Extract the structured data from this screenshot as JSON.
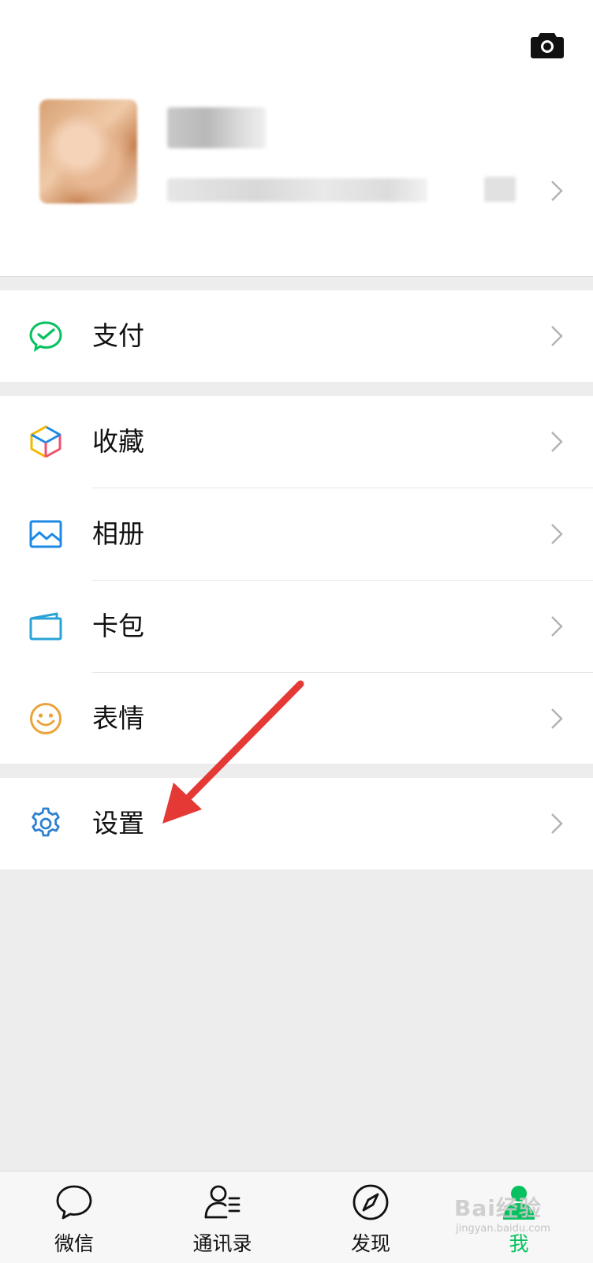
{
  "profile": {
    "camera_icon": "camera-icon",
    "chevron_icon": "chevron-right-icon"
  },
  "menu": {
    "pay": {
      "label": "支付",
      "icon": "wechat-pay-icon",
      "color": "#07c160"
    },
    "favorites": {
      "label": "收藏",
      "icon": "favorites-cube-icon"
    },
    "album": {
      "label": "相册",
      "icon": "album-image-icon",
      "color": "#1e8ae6"
    },
    "cards": {
      "label": "卡包",
      "icon": "card-wallet-icon",
      "color": "#2aa3d6"
    },
    "stickers": {
      "label": "表情",
      "icon": "emoji-smile-icon",
      "color": "#eba43a"
    },
    "settings": {
      "label": "设置",
      "icon": "gear-icon",
      "color": "#2f81d1"
    }
  },
  "tabs": [
    {
      "label": "微信",
      "icon": "chat-bubble-icon"
    },
    {
      "label": "通讯录",
      "icon": "contacts-icon"
    },
    {
      "label": "发现",
      "icon": "compass-icon"
    },
    {
      "label": "我",
      "icon": "me-person-icon",
      "active": true,
      "color": "#07c160"
    }
  ],
  "annotation": {
    "arrow_color": "#e53935"
  },
  "watermark": {
    "brand": "Bai经验",
    "site": "jingyan.baidu.com"
  }
}
